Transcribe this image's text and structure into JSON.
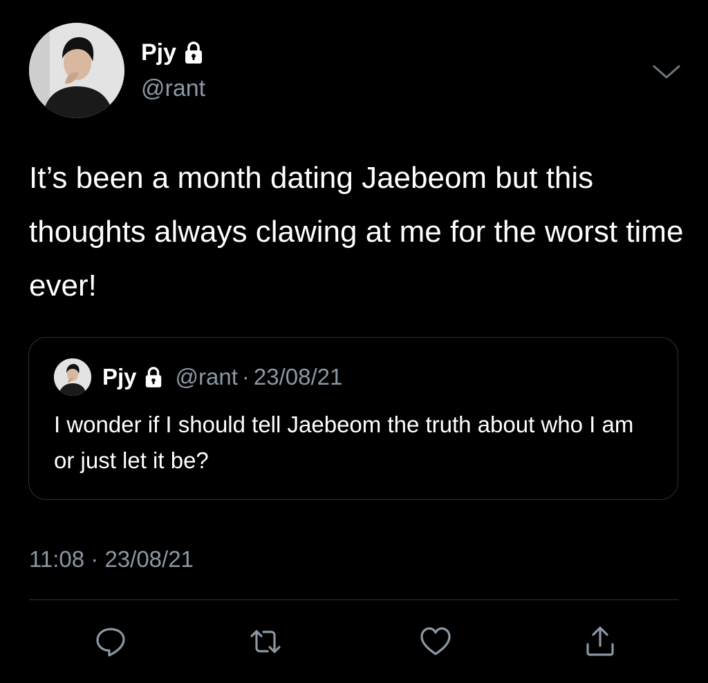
{
  "author": {
    "name": "Pjy",
    "handle": "@rant",
    "avatar_icon": "profile-photo",
    "protected_icon": "lock-icon"
  },
  "tweet": {
    "text": "It’s been a month dating Jaebeom but this thoughts always clawing at me for the worst time ever!",
    "timestamp": "11:08 · 23/08/21"
  },
  "quoted_tweet": {
    "name": "Pjy",
    "handle": "@rant",
    "separator": "·",
    "date": "23/08/21",
    "text": "I wonder if I should tell Jaebeom the truth about who I am or just let it be?"
  },
  "actions": [
    {
      "icon": "reply-icon"
    },
    {
      "icon": "retweet-icon"
    },
    {
      "icon": "like-icon"
    },
    {
      "icon": "share-icon"
    }
  ],
  "colors": {
    "background": "#000000",
    "text": "#ffffff",
    "secondary_text": "#8b98a5",
    "border": "#2f3336"
  }
}
